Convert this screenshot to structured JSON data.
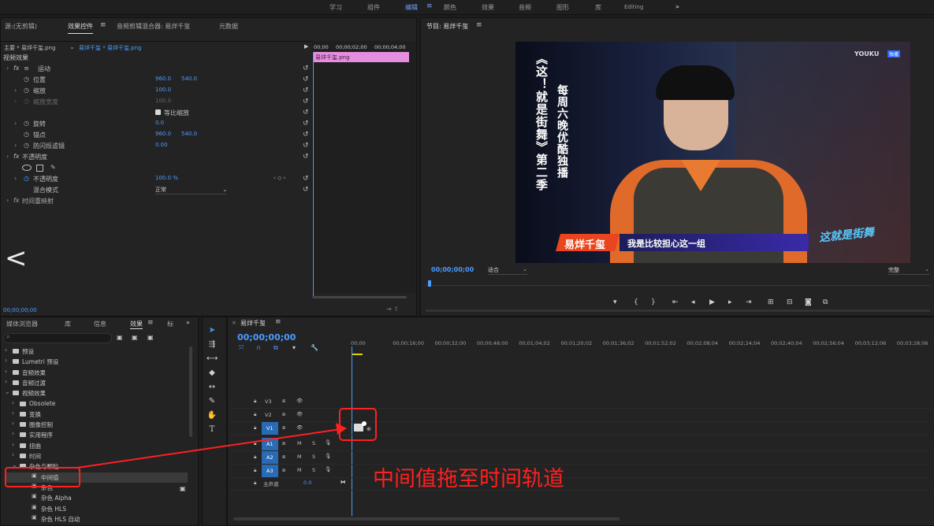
{
  "workspaces": [
    "学习",
    "组件",
    "编辑",
    "颜色",
    "效果",
    "音频",
    "图形",
    "库",
    "Editing"
  ],
  "workspace_active": "编辑",
  "workspace_more": "»",
  "menu_icon": "≡",
  "effect_panel": {
    "tabs": [
      "源:(无剪辑)",
      "效果控件",
      "音频剪辑混合器: 易烊千玺",
      "元数据"
    ],
    "clip_path": "主要 * 易烊千玺.png",
    "clip_link": "易烊千玺 * 易烊千玺.png",
    "mini_timecodes": [
      "00;00",
      "00;00;02;00",
      "00;00;04;00"
    ],
    "mini_clip": "易烊千玺.png",
    "section": "视频效果",
    "props": [
      {
        "fx": "fx",
        "label": "运动"
      },
      {
        "label": "位置",
        "v1": "960.0",
        "v2": "540.0"
      },
      {
        "label": "缩放",
        "v1": "100.0"
      },
      {
        "label": "缩放宽度",
        "v1": "100.0"
      },
      {
        "label": "等比缩放"
      },
      {
        "label": "旋转",
        "v1": "0.0"
      },
      {
        "label": "锚点",
        "v1": "960.0",
        "v2": "540.0"
      },
      {
        "label": "防闪烁滤镜",
        "v1": "0.00"
      },
      {
        "fx": "fx",
        "label": "不透明度"
      },
      {
        "label": "不透明度",
        "v1": "100.0 %"
      },
      {
        "label": "混合模式",
        "v1": "正常"
      },
      {
        "fx": "fx",
        "label": "时间重映射"
      }
    ],
    "timecode": "00;00;00;00",
    "back_arrow": "<"
  },
  "program": {
    "title": "节目: 易烊千玺",
    "timecode": "00;00;00;00",
    "fit": "适合",
    "quality": "完整",
    "logo": "YOUKU",
    "logo_badge": "独播",
    "vertical_1": "《这！就是街舞》第二季",
    "vertical_2": "每周六晚优酷独播",
    "name_tag": "易烊千玺",
    "subtitle": "我是比较担心这一组",
    "show_logo": "这就是街舞"
  },
  "effects_browser": {
    "tabs": [
      "媒体浏览器",
      "库",
      "信息",
      "效果",
      "标"
    ],
    "more": "»",
    "items": [
      {
        "label": "预设",
        "d": 0
      },
      {
        "label": "Lumetri 预设",
        "d": 0
      },
      {
        "label": "音频效果",
        "d": 0
      },
      {
        "label": "音频过渡",
        "d": 0
      },
      {
        "label": "视频效果",
        "d": 0,
        "open": true
      },
      {
        "label": "Obsolete",
        "d": 1
      },
      {
        "label": "变换",
        "d": 1
      },
      {
        "label": "图像控制",
        "d": 1
      },
      {
        "label": "实用程序",
        "d": 1
      },
      {
        "label": "扭曲",
        "d": 1
      },
      {
        "label": "时间",
        "d": 1
      },
      {
        "label": "杂色与颗粒",
        "d": 1,
        "open": true
      },
      {
        "label": "中间值",
        "d": 2,
        "sel": true
      },
      {
        "label": "杂色",
        "d": 2
      },
      {
        "label": "杂色 Alpha",
        "d": 2
      },
      {
        "label": "杂色 HLS",
        "d": 2
      },
      {
        "label": "杂色 HLS 自动",
        "d": 2
      }
    ]
  },
  "timeline": {
    "title": "易烊千玺",
    "timecode": "00;00;00;00",
    "ruler": [
      "00;00",
      "00;00;16;00",
      "00;00;32;00",
      "00;00;48;00",
      "00;01;04;02",
      "00;01;20;02",
      "00;01;36;02",
      "00;01;52;02",
      "00;02;08;04",
      "00;02;24;04",
      "00;02;40;04",
      "00;02;56;04",
      "00;03;12;06",
      "00;03;28;06",
      "00"
    ],
    "video_tracks": [
      "V3",
      "V2",
      "V1"
    ],
    "audio_tracks": [
      "A1",
      "A2",
      "A3"
    ],
    "master": "主声道",
    "master_val": "0.0",
    "track_m": "M",
    "track_s": "S"
  },
  "annotation": {
    "text": "中间值拖至时间轨道",
    "color": "#ff2020"
  },
  "colors": {
    "accent": "#4b9cff",
    "clip_pink": "#e58ee0",
    "annotation": "#ff2020"
  }
}
